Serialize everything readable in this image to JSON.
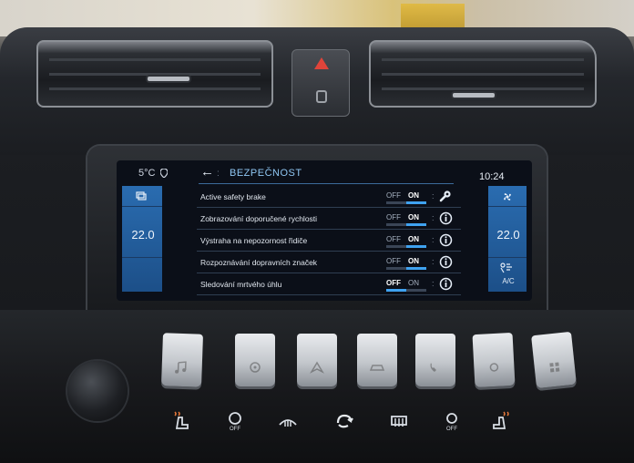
{
  "status_bar": {
    "outside_temp": "5°C",
    "back_arrow": "←",
    "separator": ":",
    "title": "BEZPEČNOST",
    "clock": "10:24"
  },
  "climate": {
    "left_temp": "22.0",
    "right_temp": "22.0",
    "ac_label": "A/C",
    "icons": [
      "seat-heat-icon",
      "fan-icon",
      "airflow-icon"
    ]
  },
  "settings": [
    {
      "label": "Active safety brake",
      "off": "OFF",
      "on": "ON",
      "state": "on",
      "icon": "wrench-icon"
    },
    {
      "label": "Zobrazování doporučené rychlosti",
      "off": "OFF",
      "on": "ON",
      "state": "on",
      "icon": "info-icon"
    },
    {
      "label": "Výstraha na nepozornost řidiče",
      "off": "OFF",
      "on": "ON",
      "state": "on",
      "icon": "info-icon"
    },
    {
      "label": "Rozpoznávání dopravních značek",
      "off": "OFF",
      "on": "ON",
      "state": "on",
      "icon": "info-icon"
    },
    {
      "label": "Sledování mrtvého úhlu",
      "off": "OFF",
      "on": "ON",
      "state": "off",
      "icon": "info-icon"
    }
  ],
  "row_separator": ":",
  "colors": {
    "accent": "#3fa2f0",
    "panel_blue": "#2a6cb0",
    "title_blue": "#8fc6f2"
  },
  "piano_keys": [
    "music-icon",
    "fan-icon",
    "navigation-icon",
    "car-icon",
    "phone-icon",
    "settings-icon",
    "apps-icon"
  ],
  "hvac_buttons": [
    "seat-heat-left-icon",
    "auto-off-icon",
    "windshield-defrost-icon",
    "recirculation-icon",
    "rear-defrost-icon",
    "fan-off-icon",
    "seat-heat-right-icon"
  ]
}
